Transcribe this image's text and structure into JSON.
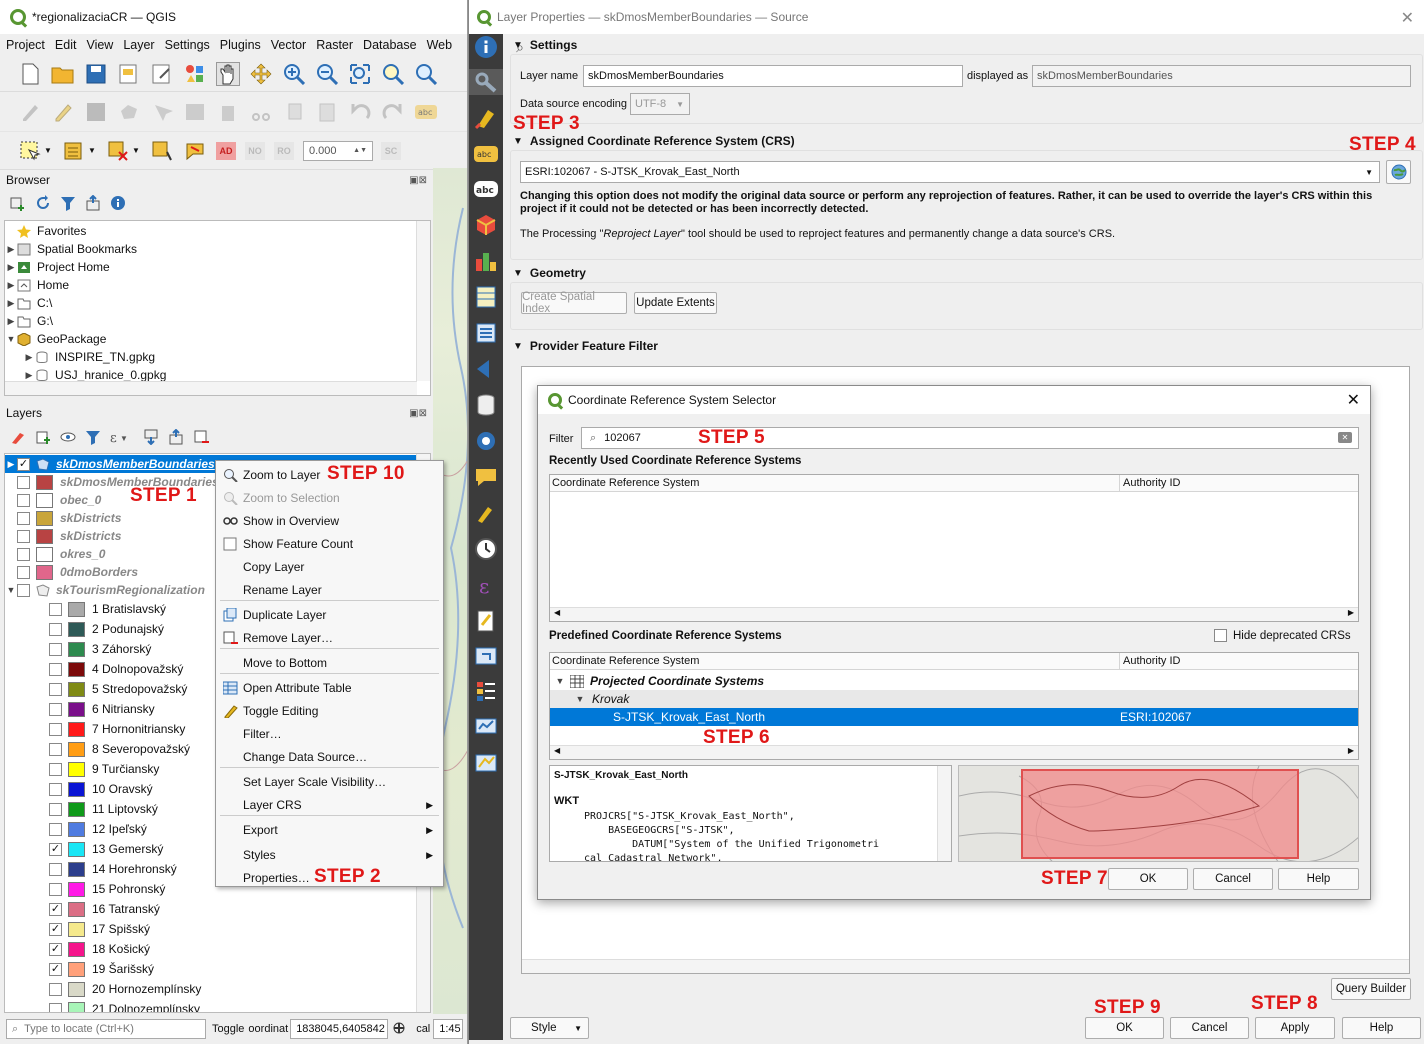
{
  "qgis": {
    "title": "*regionalizaciaCR — QGIS",
    "menu": [
      "Project",
      "Edit",
      "View",
      "Layer",
      "Settings",
      "Plugins",
      "Vector",
      "Raster",
      "Database",
      "Web"
    ],
    "spin_value": "0.000",
    "toolbar_text": {
      "ad": "AD",
      "no": "NO",
      "ro": "RO",
      "sc": "SC",
      "abc": "abc"
    },
    "browser": {
      "title": "Browser",
      "items": [
        "Favorites",
        "Spatial Bookmarks",
        "Project Home",
        "Home",
        "C:\\",
        "G:\\",
        "GeoPackage"
      ],
      "sub_items": [
        "INSPIRE_TN.gpkg",
        "USJ_hranice_0.gpkg"
      ]
    },
    "layers": {
      "title": "Layers",
      "top_layers": [
        {
          "name": "skDmosMemberBoundaries",
          "checked": true,
          "selected": true,
          "color": ""
        },
        {
          "name": "skDmosMemberBoundaries",
          "checked": false,
          "color": "#b84343"
        },
        {
          "name": "obec_0",
          "checked": false,
          "color": "#ffffff"
        },
        {
          "name": "skDistricts",
          "checked": false,
          "color": "#c9a53a"
        },
        {
          "name": "skDistricts",
          "checked": false,
          "color": "#b84343"
        },
        {
          "name": "okres_0",
          "checked": false,
          "color": "#ffffff"
        },
        {
          "name": "0dmoBorders",
          "checked": false,
          "color": "#e0668b"
        },
        {
          "name": "skTourismRegionalization",
          "checked": false,
          "color": ""
        }
      ],
      "regions": [
        {
          "name": "1 Bratislavský",
          "checked": false,
          "color": "#a9a9a9"
        },
        {
          "name": "2 Podunajský",
          "checked": false,
          "color": "#2e5a57"
        },
        {
          "name": "3 Záhorský",
          "checked": false,
          "color": "#2d8a4e"
        },
        {
          "name": "4 Dolnopovažský",
          "checked": false,
          "color": "#7c0a0a"
        },
        {
          "name": "5 Stredopovažský",
          "checked": false,
          "color": "#7f8a14"
        },
        {
          "name": "6 Nitriansky",
          "checked": false,
          "color": "#7a0f8a"
        },
        {
          "name": "7 Hornonitriansky",
          "checked": false,
          "color": "#ff1a1a"
        },
        {
          "name": "8 Severopovažský",
          "checked": false,
          "color": "#ff9d14"
        },
        {
          "name": "9 Turčiansky",
          "checked": false,
          "color": "#ffff00"
        },
        {
          "name": "10 Oravský",
          "checked": false,
          "color": "#0a14d4"
        },
        {
          "name": "11 Liptovský",
          "checked": false,
          "color": "#0f9a1a"
        },
        {
          "name": "12 Ipeľský",
          "checked": false,
          "color": "#4f7be0"
        },
        {
          "name": "13 Gemerský",
          "checked": true,
          "color": "#1ae6f5"
        },
        {
          "name": "14 Horehronský",
          "checked": false,
          "color": "#2c3e8c"
        },
        {
          "name": "15 Pohronský",
          "checked": false,
          "color": "#ff1ae6"
        },
        {
          "name": "16 Tatranský",
          "checked": true,
          "color": "#db6e85"
        },
        {
          "name": "17 Spišský",
          "checked": true,
          "color": "#f5e98c"
        },
        {
          "name": "18 Košický",
          "checked": true,
          "color": "#f5148c"
        },
        {
          "name": "19 Šarišský",
          "checked": true,
          "color": "#ffa07a"
        },
        {
          "name": "20 Hornozemplínsky",
          "checked": false,
          "color": "#d9d9c8"
        },
        {
          "name": "21 Dolnozemplínsky",
          "checked": false,
          "color": "#a8f5b8"
        }
      ]
    },
    "status": {
      "locate_placeholder": "Type to locate (Ctrl+K)",
      "toggle": "Toggle",
      "coord_label": "oordinat",
      "coord": "1838045,6405842",
      "scale_label": "cal",
      "scale": "1:45"
    }
  },
  "context_menu": {
    "items": [
      {
        "label": "Zoom to Layer",
        "disabled": false
      },
      {
        "label": "Zoom to Selection",
        "disabled": true
      },
      {
        "label": "Show in Overview",
        "disabled": false
      },
      {
        "label": "Show Feature Count",
        "disabled": false
      },
      {
        "label": "Copy Layer",
        "disabled": false
      },
      {
        "label": "Rename Layer",
        "disabled": false
      },
      {
        "label": "Duplicate Layer",
        "disabled": false
      },
      {
        "label": "Remove Layer…",
        "disabled": false
      },
      {
        "label": "Move to Bottom",
        "disabled": false
      },
      {
        "label": "Open Attribute Table",
        "disabled": false
      },
      {
        "label": "Toggle Editing",
        "disabled": false
      },
      {
        "label": "Filter…",
        "disabled": false
      },
      {
        "label": "Change Data Source…",
        "disabled": false
      },
      {
        "label": "Set Layer Scale Visibility…",
        "disabled": false
      },
      {
        "label": "Layer CRS",
        "disabled": false
      },
      {
        "label": "Export",
        "disabled": false
      },
      {
        "label": "Styles",
        "disabled": false
      },
      {
        "label": "Properties…",
        "disabled": false
      }
    ]
  },
  "layer_props": {
    "title": "Layer Properties — skDmosMemberBoundaries — Source",
    "settings": {
      "header": "Settings",
      "layer_name_label": "Layer name",
      "layer_name": "skDmosMemberBoundaries",
      "displayed_as_label": "displayed as",
      "displayed_as": "skDmosMemberBoundaries",
      "encoding_label": "Data source encoding",
      "encoding": "UTF-8"
    },
    "crs_section": {
      "header": "Assigned Coordinate Reference System (CRS)",
      "value": "ESRI:102067 - S-JTSK_Krovak_East_North",
      "warning": "Changing this option does not modify the original data source or perform any reprojection of features. Rather, it can be used to override the layer's CRS within this project if it could not be detected or has been incorrectly detected.",
      "note_pre": "The Processing \"",
      "note_em": "Reproject Layer",
      "note_post": "\" tool should be used to reproject features and permanently change a data source's CRS."
    },
    "geometry": {
      "header": "Geometry",
      "create_index": "Create Spatial Index",
      "update_extents": "Update Extents"
    },
    "filter": {
      "header": "Provider Feature Filter",
      "query_builder": "Query Builder"
    },
    "buttons": {
      "style": "Style",
      "ok": "OK",
      "cancel": "Cancel",
      "apply": "Apply",
      "help": "Help"
    }
  },
  "crs_dialog": {
    "title": "Coordinate Reference System Selector",
    "filter_label": "Filter",
    "filter_value": "102067",
    "recent_header": "Recently Used Coordinate Reference Systems",
    "col_crs": "Coordinate Reference System",
    "col_auth": "Authority ID",
    "predefined_header": "Predefined Coordinate Reference Systems",
    "hide_deprecated": "Hide deprecated CRSs",
    "tree_group": "Projected Coordinate Systems",
    "tree_sub": "Krovak",
    "tree_item": "S-JTSK_Krovak_East_North",
    "tree_item_auth": "ESRI:102067",
    "wkt_name": "S-JTSK_Krovak_East_North",
    "wkt_label": "WKT",
    "wkt_lines": [
      "PROJCRS[\"S-JTSK_Krovak_East_North\",",
      "    BASEGEOGCRS[\"S-JTSK\",",
      "        DATUM[\"System of the Unified Trigonometri",
      "cal Cadastral Network\","
    ],
    "ok": "OK",
    "cancel": "Cancel",
    "help": "Help"
  },
  "steps": {
    "s1": "STEP 1",
    "s2": "STEP 2",
    "s3": "STEP 3",
    "s4": "STEP 4",
    "s5": "STEP 5",
    "s6": "STEP 6",
    "s7": "STEP 7",
    "s8": "STEP 8",
    "s9": "STEP 9",
    "s10": "STEP 10"
  },
  "colors": {
    "accent": "#0078d7",
    "step": "#e01818",
    "qgis_green": "#589632",
    "sidebar": "#3b3b3b"
  }
}
